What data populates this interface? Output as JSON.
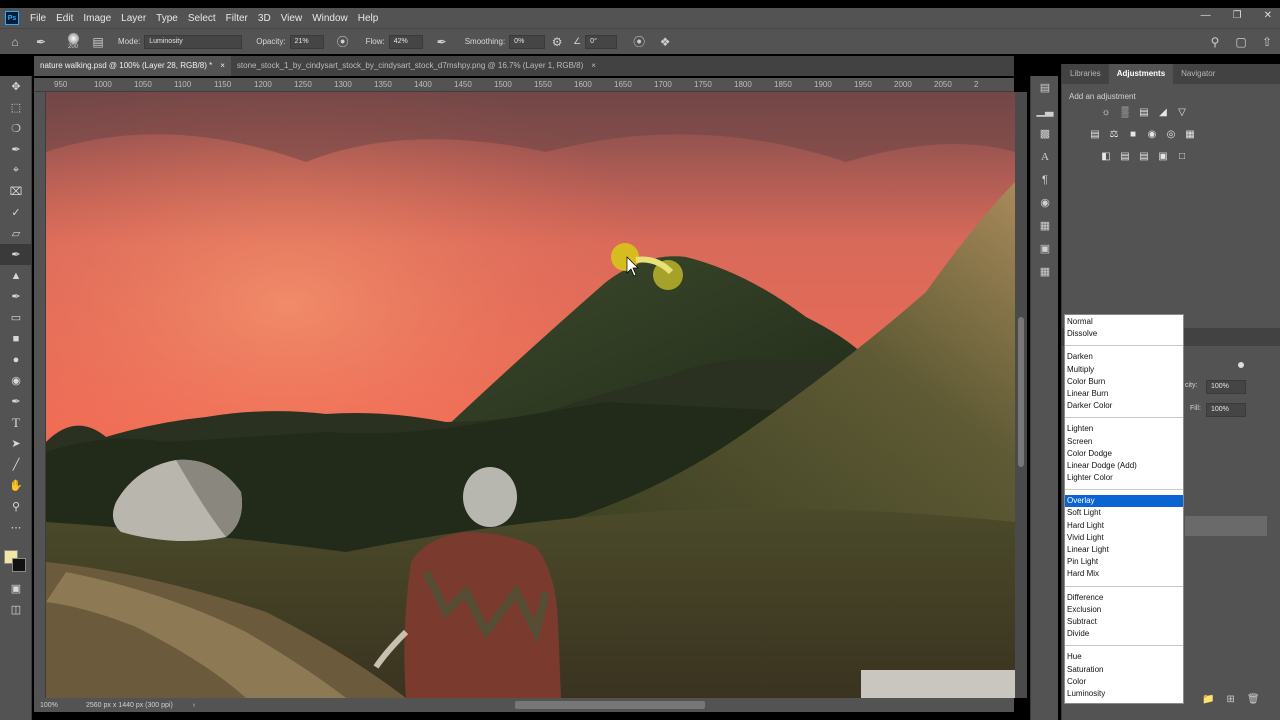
{
  "app": {
    "logo": "Ps",
    "menu": [
      "File",
      "Edit",
      "Image",
      "Layer",
      "Type",
      "Select",
      "Filter",
      "3D",
      "View",
      "Window",
      "Help"
    ]
  },
  "options": {
    "brush_size": "200",
    "mode_label": "Mode:",
    "mode_value": "Luminosity",
    "opacity_label": "Opacity:",
    "opacity_value": "21%",
    "flow_label": "Flow:",
    "flow_value": "42%",
    "smoothing_label": "Smoothing:",
    "smoothing_value": "0%",
    "angle_value": "0°"
  },
  "tabs": [
    {
      "label": "nature walking.psd @ 100% (Layer 28, RGB/8) *",
      "close": "×"
    },
    {
      "label": "stone_stock_1_by_cindysart_stock_by_cindysart_stock_d7mshpy.png @ 16.7% (Layer 1, RGB/8)",
      "close": "×"
    }
  ],
  "ruler_top": [
    "950",
    "1000",
    "1050",
    "1100",
    "1150",
    "1200",
    "1250",
    "1300",
    "1350",
    "1400",
    "1450",
    "1500",
    "1550",
    "1600",
    "1650",
    "1700",
    "1750",
    "1800",
    "1850",
    "1900",
    "1950",
    "2000",
    "2050",
    "2"
  ],
  "status": {
    "zoom": "100%",
    "doc_info": "2560 px x 1440 px (300 ppi)"
  },
  "panel": {
    "tabs": [
      "Libraries",
      "Adjustments",
      "Navigator"
    ],
    "active_tab": "Adjustments",
    "add_adjustment": "Add an adjustment",
    "layers_opacity_label": "city:",
    "layers_opacity_value": "100%",
    "layers_fill_label": "Fill:",
    "layers_fill_value": "100%"
  },
  "blend_menu": {
    "groups": [
      [
        "Normal",
        "Dissolve"
      ],
      [
        "Darken",
        "Multiply",
        "Color Burn",
        "Linear Burn",
        "Darker Color"
      ],
      [
        "Lighten",
        "Screen",
        "Color Dodge",
        "Linear Dodge (Add)",
        "Lighter Color"
      ],
      [
        "Overlay",
        "Soft Light",
        "Hard Light",
        "Vivid Light",
        "Linear Light",
        "Pin Light",
        "Hard Mix"
      ],
      [
        "Difference",
        "Exclusion",
        "Subtract",
        "Divide"
      ],
      [
        "Hue",
        "Saturation",
        "Color",
        "Luminosity"
      ]
    ],
    "selected": "Overlay"
  },
  "colors": {
    "ui_bg": "#535353",
    "selection": "#0a64d2",
    "foreground_swatch": "#f2e6a6",
    "background_swatch": "#111111"
  }
}
